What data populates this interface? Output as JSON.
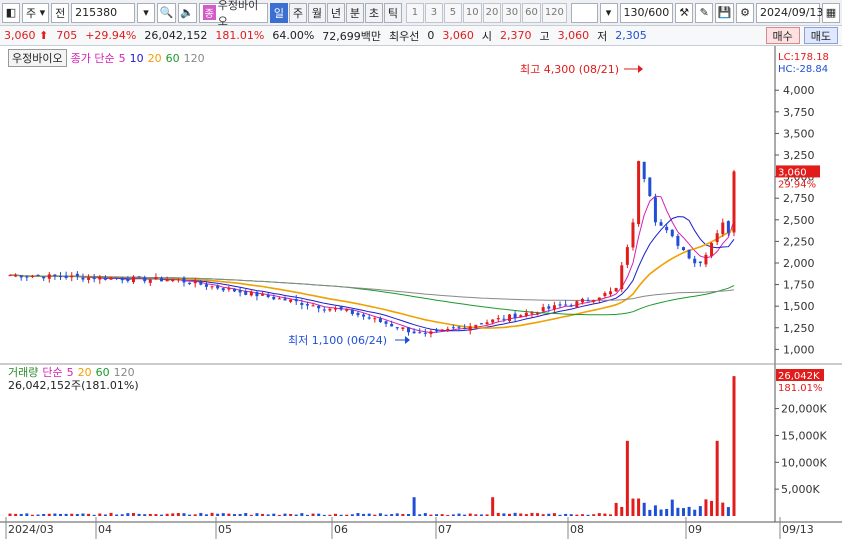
{
  "toolbar": {
    "market": "주",
    "type": "전",
    "code": "215380",
    "name_tag": "종",
    "name": "우정바이오",
    "periods": [
      "일",
      "주",
      "월",
      "년",
      "분",
      "초",
      "틱"
    ],
    "active_period": "일",
    "numbers": [
      "1",
      "3",
      "5",
      "10",
      "20",
      "30",
      "60",
      "120"
    ],
    "count": "130",
    "total": "/600",
    "date": "2024/09/13"
  },
  "quote": {
    "price": "3,060",
    "change": "705",
    "change_pct": "+29.94%",
    "volume": "26,042,152",
    "volume_ratio": "181.01%",
    "turnover": "64.00%",
    "amount": "72,699백만",
    "pref_label": "최우선",
    "pref_value": "0",
    "pref_price": "3,060",
    "open_label": "시",
    "open": "2,370",
    "high_label": "고",
    "high": "3,060",
    "low_label": "저",
    "low": "2,305",
    "buy": "매수",
    "sell": "매도"
  },
  "legend": {
    "name": "우정바이오",
    "ma_label": "종가 단순",
    "ma": [
      "5",
      "10",
      "20",
      "60",
      "120"
    ],
    "ma_colors": [
      "#d51fb6",
      "#1b1bcf",
      "#f0a000",
      "#1a9a2a",
      "#888888"
    ],
    "vol_label": "거래량",
    "vol_ma_label": "단순",
    "vol_ma": [
      "5",
      "20",
      "60",
      "120"
    ],
    "vol_text": "26,042,152주(181.01%)"
  },
  "annotations": {
    "high": "최고 4,300 (08/21)",
    "low": "최저 1,100 (06/24)",
    "lc": "LC:178.18",
    "hc": "HC:-28.84",
    "last_price": "3,060",
    "last_pct": "29.94%",
    "last_vol": "26,042K",
    "last_vol_pct": "181.01%"
  },
  "chart_data": {
    "type": "candlestick",
    "price_axis": [
      1000,
      1250,
      1500,
      1750,
      2000,
      2250,
      2500,
      2750,
      3000,
      3250,
      3500,
      3750,
      4000
    ],
    "price_labels": [
      "1,000",
      "1,250",
      "1,500",
      "1,750",
      "2,000",
      "2,250",
      "2,500",
      "2,750",
      "3,000",
      "3,250",
      "3,500",
      "3,750",
      "4,000"
    ],
    "volume_axis": [
      5000,
      10000,
      15000,
      20000
    ],
    "volume_labels": [
      "5,000K",
      "10,000K",
      "15,000K",
      "20,000K"
    ],
    "x_labels": [
      "2024/03",
      "04",
      "05",
      "06",
      "07",
      "08",
      "09",
      "09/13"
    ],
    "price_range": [
      900,
      4350
    ],
    "volume_range": [
      0,
      27000
    ],
    "colors": {
      "up": "#e21b1b",
      "down": "#1f4fd6"
    }
  }
}
